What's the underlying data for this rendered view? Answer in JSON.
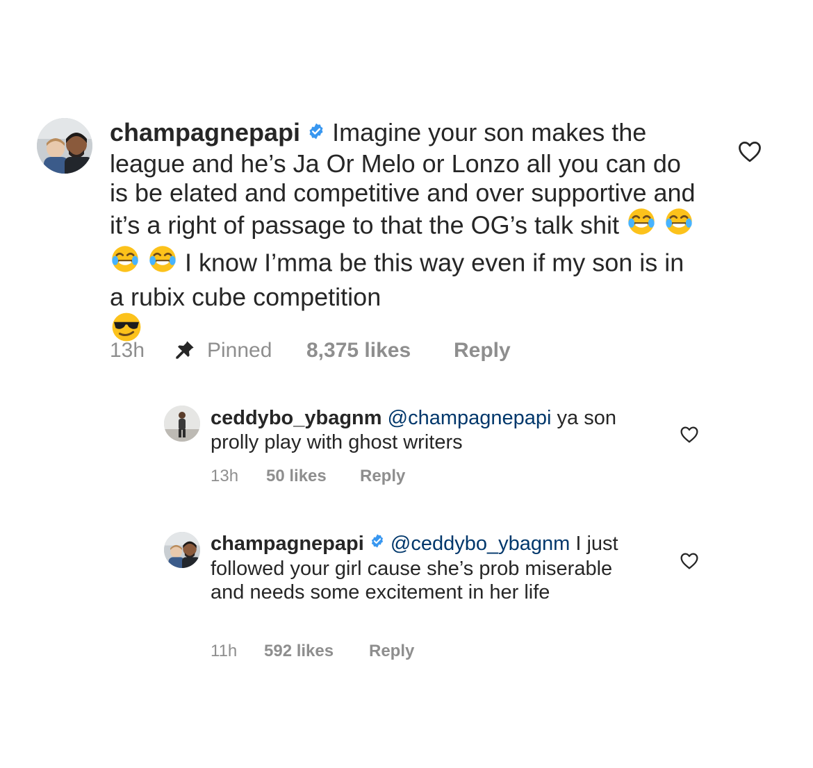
{
  "main_comment": {
    "username": "champagnepapi",
    "verified": true,
    "text_part1": "Imagine your son makes the league and he’s Ja Or Melo or Lonzo all you can do is be elated and competitive and over supportive and it’s a right of passage to that the OG’s talk shit",
    "text_part2": "I know I’mma be this way even if my son is in a rubix cube competition",
    "emoji_tears": "😂",
    "emoji_cool": "😎",
    "time": "13h",
    "pinned_label": "Pinned",
    "likes": "8,375 likes",
    "reply_label": "Reply"
  },
  "reply_1": {
    "username": "ceddybo_ybagnm",
    "mention": "@champagnepapi",
    "text": "ya son prolly play with ghost writers",
    "time": "13h",
    "likes": "50 likes",
    "reply_label": "Reply"
  },
  "reply_2": {
    "username": "champagnepapi",
    "verified": true,
    "mention": "@ceddybo_ybagnm",
    "text": "I just followed your girl cause she’s prob miserable and needs some excitement in her life",
    "time": "11h",
    "likes": "592 likes",
    "reply_label": "Reply"
  },
  "icons": {
    "like": "heart-outline-icon",
    "pinned": "pushpin-icon",
    "verified": "verified-badge-icon"
  },
  "colors": {
    "text": "#262626",
    "muted": "#8e8e8e",
    "mention": "#00376b",
    "verified": "#3897f0"
  }
}
